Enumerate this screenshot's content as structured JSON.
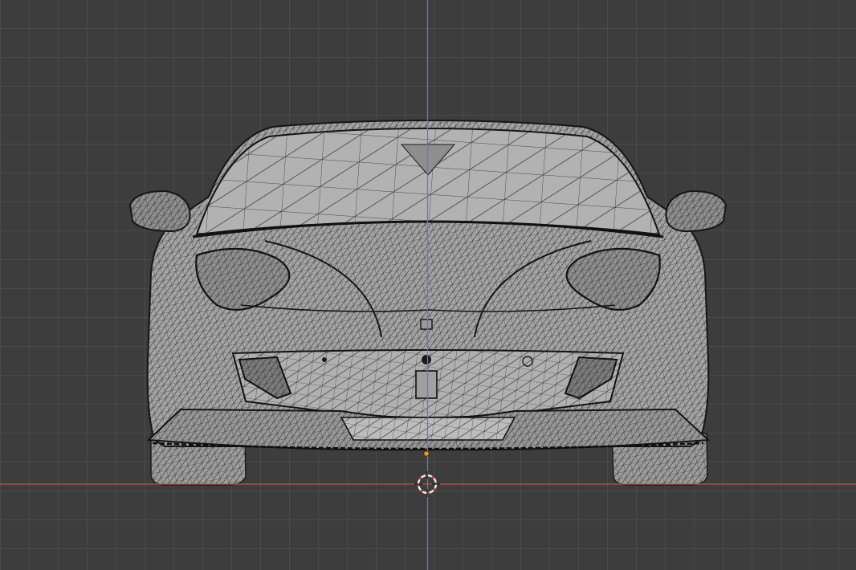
{
  "viewport": {
    "mode": "edit-mode-wireframe",
    "view": "front-orthographic",
    "colors": {
      "background": "#3d3d3d",
      "grid": "#515151",
      "x_axis": "#c0504d",
      "z_axis": "#5b7fb8",
      "mesh_face": "#a7a7a7",
      "mesh_face_dark": "#8c8c8c",
      "mesh_edge": "#1e1e1e",
      "origin": "#e8a000",
      "cursor_red": "#d24545",
      "cursor_white": "#eeeeee"
    },
    "icons": [
      "3d-cursor-icon",
      "origin-point-icon"
    ]
  }
}
